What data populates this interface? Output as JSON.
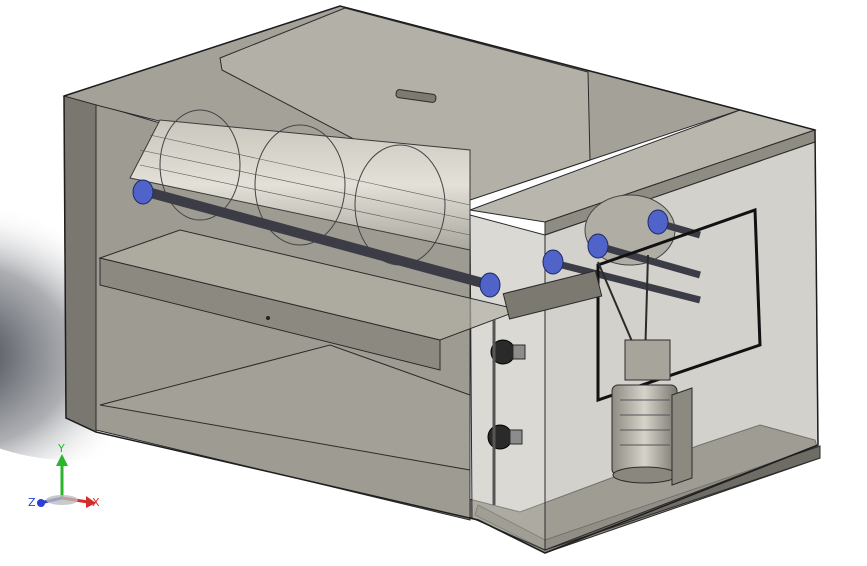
{
  "viewport": {
    "background": "#ffffff",
    "shadow_color": "#2a2f3a",
    "frame_color": "#6e6b66",
    "panel_color": "#9c998f",
    "panel_dark": "#7f7c74",
    "glass_color": "#b8b5ac",
    "edge_color": "#2b2b2b",
    "blue_part_color": "#4f63c9"
  },
  "triad": {
    "x_label": "X",
    "y_label": "Y",
    "z_label": "Z",
    "x_color": "#d42b2b",
    "y_color": "#2bb52b",
    "z_color": "#2b3fd4"
  }
}
